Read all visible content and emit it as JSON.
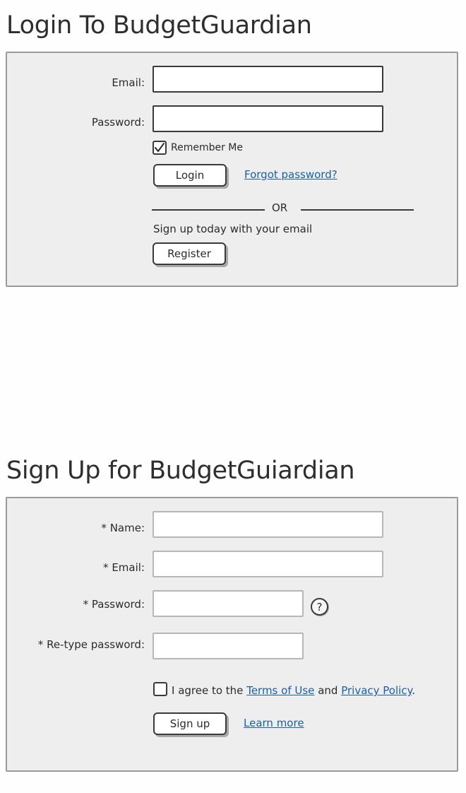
{
  "login": {
    "title": "Login To BudgetGuardian",
    "email_label": "Email:",
    "email_value": "",
    "password_label": "Password:",
    "password_value": "",
    "remember_label": "Remember Me",
    "remember_checked": true,
    "login_button": "Login",
    "forgot_link": "Forgot password?",
    "or_text": "OR",
    "signup_prompt": "Sign up today with your email",
    "register_button": "Register"
  },
  "signup": {
    "title": "Sign Up for BudgetGuiardian",
    "name_label": "* Name:",
    "name_value": "",
    "email_label": "* Email:",
    "email_value": "",
    "password_label": "* Password:",
    "password_value": "",
    "help_glyph": "?",
    "retype_label": "* Re-type password:",
    "retype_value": "",
    "agree_prefix": "I agree to the",
    "terms_link": "Terms of Use",
    "agree_and": "and",
    "privacy_link": "Privacy Policy",
    "agree_suffix": ".",
    "agree_checked": false,
    "signup_button": "Sign up",
    "learn_more_link": "Learn more"
  },
  "icons": {
    "check": "check-icon",
    "help": "question-circle-icon"
  }
}
